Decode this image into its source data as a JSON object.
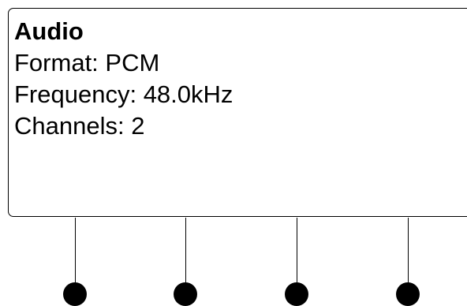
{
  "panel": {
    "title": "Audio",
    "lines": [
      "Format: PCM",
      "Frequency: 48.0kHz",
      "Channels: 2"
    ]
  },
  "connectors": {
    "count": 4,
    "color": "#000000"
  }
}
